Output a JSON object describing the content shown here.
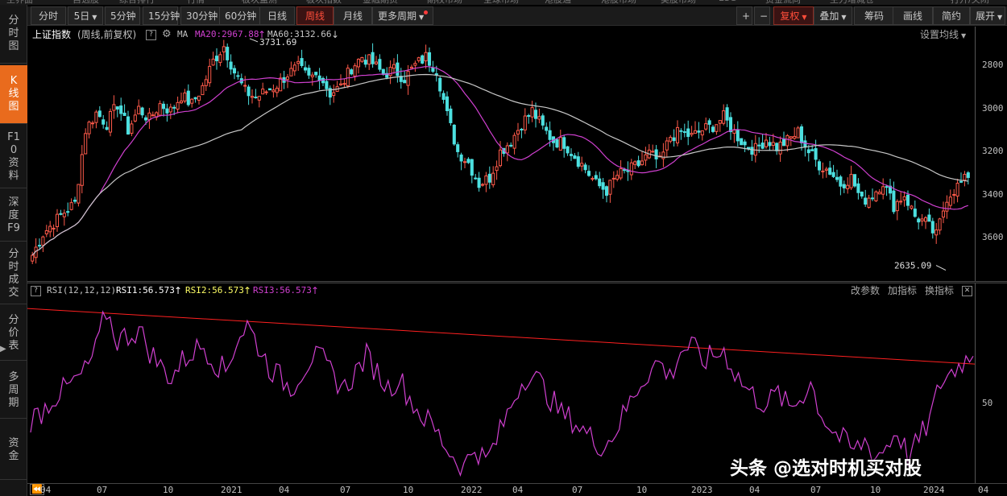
{
  "top_strip": [
    "主界面",
    "自选股",
    "综合排行",
    "行情",
    "板块监测",
    "板块指数",
    "金融期货",
    "期权市场",
    "全球市场",
    "港股通",
    "港股市场",
    "美股市场",
    "ESG",
    "资金流向",
    "主力增减仓",
    "打开/关闭"
  ],
  "sidebar": {
    "items": [
      {
        "label": "分时图",
        "active": false
      },
      {
        "label": "K线图",
        "active": true
      },
      {
        "label": "F10资料",
        "active": false
      },
      {
        "label": "深度F9",
        "active": false
      },
      {
        "label": "分时成交",
        "active": false
      },
      {
        "label": "分价表",
        "active": false
      },
      {
        "label": "多周期",
        "active": false
      },
      {
        "label": "资金",
        "active": false
      }
    ],
    "arrow": "▶"
  },
  "toolbar": {
    "period_buttons": [
      {
        "label": "分时",
        "active": false
      },
      {
        "label": "5日",
        "active": false,
        "caret": true
      },
      {
        "label": "5分钟",
        "active": false
      },
      {
        "label": "15分钟",
        "active": false
      },
      {
        "label": "30分钟",
        "active": false
      },
      {
        "label": "60分钟",
        "active": false
      },
      {
        "label": "日线",
        "active": false
      },
      {
        "label": "周线",
        "active": true
      },
      {
        "label": "月线",
        "active": false
      },
      {
        "label": "更多周期",
        "active": false,
        "caret": true,
        "dot": true
      }
    ],
    "right_buttons": [
      {
        "label": "+",
        "active": false
      },
      {
        "label": "−",
        "active": false
      },
      {
        "label": "复权",
        "active": true,
        "caret": true
      },
      {
        "label": "叠加",
        "active": false,
        "caret": true
      },
      {
        "label": "筹码",
        "active": false
      },
      {
        "label": "画线",
        "active": false
      },
      {
        "label": "简约",
        "active": false
      },
      {
        "label": "展开",
        "active": false,
        "caret": true
      }
    ]
  },
  "main_header": {
    "title": "上证指数",
    "subtitle": "(周线,前复权)",
    "help": "?",
    "ma_label": "MA",
    "ma20": "MA20:2967.88",
    "ma20_arrow": "↑",
    "ma60": "MA60:3132.66",
    "ma60_arrow": "↓",
    "settings": "设置均线",
    "colors": {
      "ma20": "#d040d0",
      "ma60": "#c8c8c8",
      "up": "#ff5a4a",
      "down": "#4ce0e0"
    }
  },
  "price_axis": [
    "3600",
    "3400",
    "3200",
    "3000",
    "2800"
  ],
  "annotations": {
    "high": "3731.69",
    "low": "2635.09"
  },
  "rsi_header": {
    "help": "?",
    "name": "RSI(12,12,12)",
    "rsi1": "RSI1:56.573",
    "rsi2": "RSI2:56.573",
    "rsi3": "RSI3:56.573",
    "arrow": "↑",
    "buttons": [
      "改参数",
      "加指标",
      "换指标"
    ],
    "close": "✕",
    "colors": {
      "rsi1": "#ffffff",
      "rsi2": "#ffff66",
      "rsi3": "#d040d0"
    }
  },
  "rsi_axis": [
    "50"
  ],
  "date_axis": [
    "04",
    "07",
    "10",
    "2021",
    "04",
    "07",
    "10",
    "2022",
    "04",
    "07",
    "10",
    "2023",
    "04",
    "07",
    "10",
    "2024",
    "04"
  ],
  "date_axis_nav": "⏪",
  "watermark": "头条 @选对时机买对股",
  "chart_data": [
    {
      "type": "candlestick",
      "title": "上证指数",
      "subtitle": "(周线,前复权)",
      "x_ticks": [
        "04",
        "07",
        "10",
        "2021",
        "04",
        "07",
        "10",
        "2022",
        "04",
        "07",
        "10",
        "2023",
        "04",
        "07",
        "10",
        "2024"
      ],
      "ylim": [
        2600,
        3780
      ],
      "y_ticks": [
        2800,
        3000,
        3200,
        3400,
        3600
      ],
      "annotations": [
        {
          "text": "3731.69",
          "value": 3731.69
        },
        {
          "text": "2635.09",
          "value": 2635.09
        }
      ],
      "close_path": [
        2720,
        2820,
        2870,
        2920,
        2960,
        3300,
        3380,
        3330,
        3420,
        3300,
        3400,
        3350,
        3420,
        3390,
        3460,
        3420,
        3500,
        3620,
        3690,
        3570,
        3480,
        3450,
        3480,
        3510,
        3560,
        3590,
        3540,
        3560,
        3470,
        3500,
        3590,
        3640,
        3610,
        3560,
        3580,
        3540,
        3600,
        3640,
        3580,
        3370,
        3200,
        3150,
        3050,
        3080,
        3200,
        3250,
        3330,
        3390,
        3310,
        3250,
        3240,
        3180,
        3120,
        3050,
        3020,
        3090,
        3110,
        3140,
        3190,
        3150,
        3270,
        3290,
        3270,
        3300,
        3320,
        3360,
        3290,
        3230,
        3210,
        3260,
        3220,
        3250,
        3290,
        3200,
        3140,
        3110,
        3050,
        3080,
        2970,
        3000,
        3060,
        2950,
        3000,
        2900,
        2870,
        2810,
        2990,
        3040,
        3080
      ],
      "series": [
        {
          "name": "MA20",
          "color": "#d040d0",
          "last": 2967.88
        },
        {
          "name": "MA60",
          "color": "#c8c8c8",
          "last": 3132.66
        }
      ]
    },
    {
      "type": "line",
      "title": "RSI(12,12,12)",
      "y_ticks": [
        50
      ],
      "values": [
        44,
        47,
        52,
        55,
        58,
        62,
        70,
        85,
        74,
        76,
        78,
        70,
        64,
        60,
        66,
        70,
        72,
        66,
        62,
        74,
        80,
        72,
        64,
        60,
        56,
        62,
        68,
        66,
        60,
        56,
        62,
        68,
        62,
        56,
        60,
        52,
        46,
        42,
        36,
        30,
        26,
        34,
        28,
        36,
        46,
        56,
        62,
        58,
        52,
        46,
        44,
        40,
        36,
        34,
        40,
        48,
        56,
        62,
        66,
        60,
        70,
        72,
        66,
        68,
        70,
        62,
        56,
        52,
        50,
        54,
        48,
        52,
        58,
        46,
        40,
        36,
        32,
        36,
        30,
        34,
        40,
        30,
        36,
        44,
        58,
        62,
        66,
        68
      ],
      "trendline": {
        "from": 86,
        "to": 65,
        "color": "#ff2020"
      },
      "series": [
        {
          "name": "RSI3",
          "color": "#d040d0",
          "last": 56.573
        }
      ]
    }
  ]
}
